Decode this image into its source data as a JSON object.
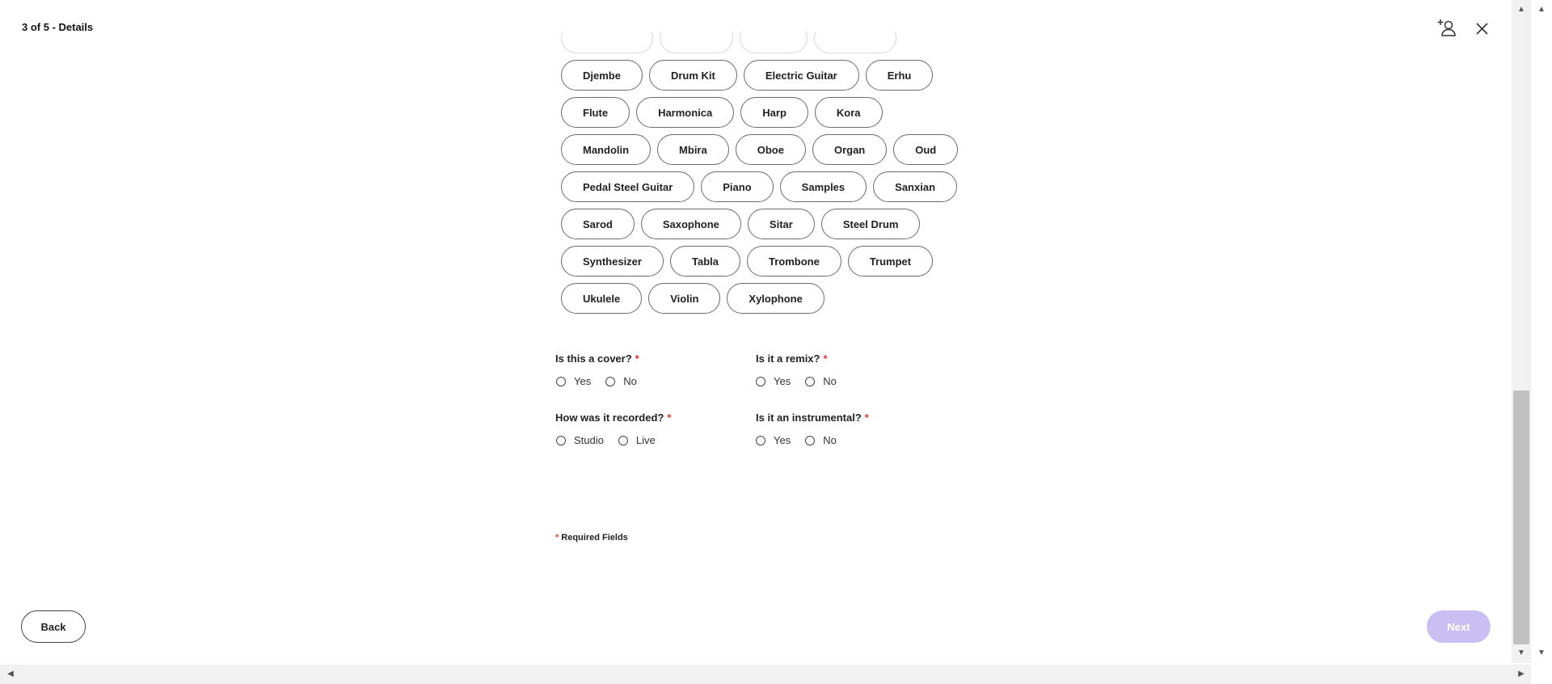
{
  "header": {
    "title": "3 of 5 - Details",
    "add_collaborator_icon": "person-plus-icon",
    "close_icon": "close-icon"
  },
  "instruments": {
    "rows": [
      [
        "",
        "",
        "",
        ""
      ],
      [
        "Djembe",
        "Drum Kit",
        "Electric Guitar",
        "Erhu"
      ],
      [
        "Flute",
        "Harmonica",
        "Harp",
        "Kora"
      ],
      [
        "Mandolin",
        "Mbira",
        "Oboe",
        "Organ",
        "Oud"
      ],
      [
        "Pedal Steel Guitar",
        "Piano",
        "Samples",
        "Sanxian"
      ],
      [
        "Sarod",
        "Saxophone",
        "Sitar",
        "Steel Drum"
      ],
      [
        "Synthesizer",
        "Tabla",
        "Trombone",
        "Trumpet"
      ],
      [
        "Ukulele",
        "Violin",
        "Xylophone"
      ]
    ]
  },
  "questions": {
    "cover": {
      "label": "Is this a cover?",
      "required_mark": "*",
      "options": [
        "Yes",
        "No"
      ]
    },
    "remix": {
      "label": "Is it a remix?",
      "required_mark": "*",
      "options": [
        "Yes",
        "No"
      ]
    },
    "recorded": {
      "label": "How was it recorded?",
      "required_mark": "*",
      "options": [
        "Studio",
        "Live"
      ]
    },
    "instrumental": {
      "label": "Is it an instrumental?",
      "required_mark": "*",
      "options": [
        "Yes",
        "No"
      ]
    }
  },
  "footer": {
    "required_mark": "*",
    "required_note": "Required Fields",
    "back_label": "Back",
    "next_label": "Next"
  },
  "colors": {
    "required_star": "#e0353d",
    "next_disabled_bg": "#c9bff3",
    "chip_border": "#6b6b6b"
  }
}
